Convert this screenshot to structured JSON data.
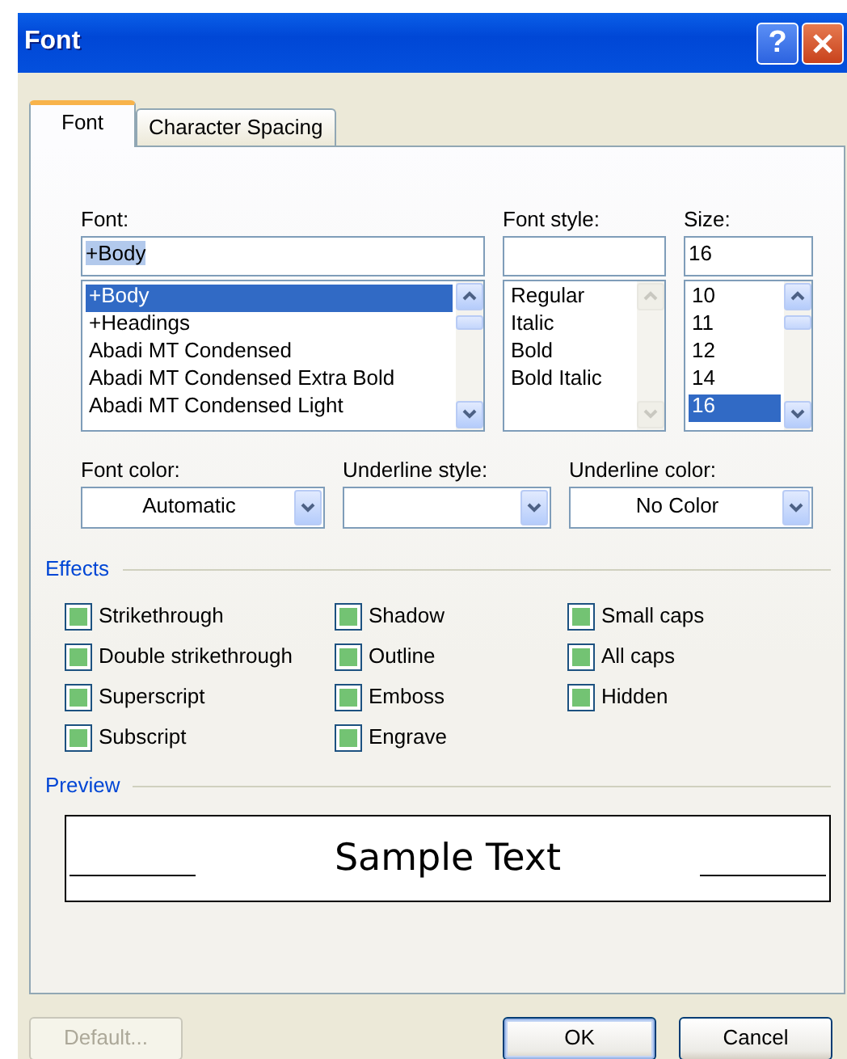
{
  "window": {
    "title": "Font",
    "help_button": "?"
  },
  "tabs": [
    {
      "label": "Font",
      "selected": true
    },
    {
      "label": "Character Spacing",
      "selected": false
    }
  ],
  "font": {
    "label": "Font:",
    "value": "+Body",
    "value_selected": true,
    "items": [
      {
        "text": "+Body",
        "selected": true
      },
      {
        "text": "+Headings",
        "selected": false
      },
      {
        "text": "Abadi MT Condensed",
        "selected": false
      },
      {
        "text": "Abadi MT Condensed Extra Bold",
        "selected": false
      },
      {
        "text": "Abadi MT Condensed Light",
        "selected": false
      }
    ],
    "scroll_disabled": false
  },
  "font_style": {
    "label": "Font style:",
    "items": [
      {
        "text": "Regular",
        "selected": false
      },
      {
        "text": "Italic",
        "selected": false
      },
      {
        "text": "Bold",
        "selected": false
      },
      {
        "text": "Bold Italic",
        "selected": false
      }
    ],
    "scroll_disabled": true
  },
  "size": {
    "label": "Size:",
    "value": "16",
    "items": [
      {
        "text": "10",
        "selected": false
      },
      {
        "text": "11",
        "selected": false
      },
      {
        "text": "12",
        "selected": false
      },
      {
        "text": "14",
        "selected": false
      },
      {
        "text": "16",
        "selected": true
      }
    ],
    "scroll_disabled": false
  },
  "dropdowns": [
    {
      "label": "Font color:",
      "value": "Automatic"
    },
    {
      "label": "Underline style:"
    },
    {
      "label": "Underline color:",
      "value": "No Color"
    }
  ],
  "effects": {
    "title": "Effects",
    "columns": [
      [
        {
          "label": "Strikethrough",
          "mixed": true
        },
        {
          "label": "Double strikethrough",
          "mixed": true
        },
        {
          "label": "Superscript",
          "mixed": true
        },
        {
          "label": "Subscript",
          "mixed": true
        }
      ],
      [
        {
          "label": "Shadow",
          "mixed": true
        },
        {
          "label": "Outline",
          "mixed": true
        },
        {
          "label": "Emboss",
          "mixed": true
        },
        {
          "label": "Engrave",
          "mixed": true
        }
      ],
      [
        {
          "label": "Small caps",
          "mixed": true
        },
        {
          "label": "All caps",
          "mixed": true
        },
        {
          "label": "Hidden",
          "mixed": true
        }
      ]
    ]
  },
  "preview": {
    "title": "Preview",
    "sample": "Sample Text"
  },
  "buttons": [
    {
      "label": "Default...",
      "disabled": true,
      "default": false
    },
    {
      "label": "OK",
      "disabled": false,
      "default": true
    },
    {
      "label": "Cancel",
      "disabled": false,
      "default": false
    }
  ]
}
